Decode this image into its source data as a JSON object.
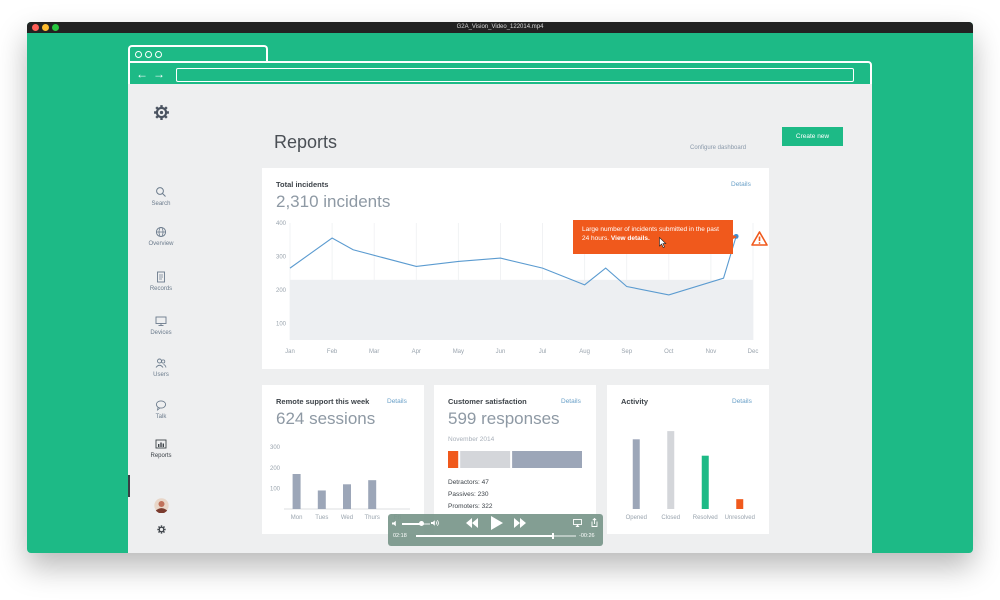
{
  "window": {
    "title": "G2A_Vision_Video_122014.mp4"
  },
  "colors": {
    "brand_green": "#1dba86",
    "alert_orange": "#f0591c",
    "bar_gray": "#9ca6b8",
    "bar_light": "#d4d6da"
  },
  "sidebar": {
    "items": [
      {
        "label": "Search",
        "icon": "search-icon"
      },
      {
        "label": "Overview",
        "icon": "globe-icon"
      },
      {
        "label": "Records",
        "icon": "document-icon"
      },
      {
        "label": "Devices",
        "icon": "monitor-icon"
      },
      {
        "label": "Users",
        "icon": "users-icon"
      },
      {
        "label": "Talk",
        "icon": "chat-icon"
      },
      {
        "label": "Reports",
        "icon": "chart-icon",
        "active": true
      }
    ]
  },
  "header": {
    "title": "Reports",
    "configure_label": "Configure dashboard",
    "create_label": "Create new"
  },
  "incidents": {
    "title": "Total incidents",
    "big": "2,310 incidents",
    "details": "Details",
    "alert_text": "Large number of incidents submitted in the past 24 hours.",
    "alert_link": "View details."
  },
  "remote": {
    "title": "Remote support this week",
    "big": "624 sessions",
    "details": "Details"
  },
  "satisfaction": {
    "title": "Customer satisfaction",
    "big": "599 responses",
    "subtitle": "November 2014",
    "details": "Details",
    "detractors": "Detractors: 47",
    "passives": "Passives: 230",
    "promoters": "Promoters: 322",
    "segments": [
      47,
      230,
      322
    ]
  },
  "activity": {
    "title": "Activity",
    "details": "Details"
  },
  "player": {
    "elapsed": "02:18",
    "remaining": "-00:26",
    "volume": 0.7,
    "progress": 0.85
  },
  "chart_data": [
    {
      "type": "line",
      "categories": [
        "Jan",
        "Feb",
        "Mar",
        "Apr",
        "May",
        "Jun",
        "Jul",
        "Aug",
        "Sep",
        "Oct",
        "Nov",
        "Dec"
      ],
      "series": [
        {
          "x": [
            0,
            1,
            1.5,
            3,
            4,
            5,
            6,
            7,
            7.5,
            8,
            9,
            10.3,
            10.6
          ],
          "values": [
            265,
            355,
            320,
            270,
            285,
            295,
            265,
            215,
            265,
            210,
            185,
            235,
            360
          ]
        }
      ],
      "yticks": [
        100,
        200,
        300,
        400
      ],
      "ylim": [
        50,
        400
      ],
      "band": [
        0,
        230
      ],
      "grid": true
    },
    {
      "type": "bar",
      "categories": [
        "Mon",
        "Tues",
        "Wed",
        "Thurs",
        "Fri"
      ],
      "values": [
        170,
        90,
        120,
        140,
        0
      ],
      "yticks": [
        100,
        200,
        300
      ],
      "ylim": [
        0,
        340
      ]
    },
    {
      "type": "bar",
      "categories": [
        "Opened",
        "Closed",
        "Resolved",
        "Unresolved"
      ],
      "values": [
        85,
        95,
        65,
        12
      ],
      "ylim": [
        0,
        100
      ],
      "colors": [
        "#9ca6b8",
        "#d4d6da",
        "#1dba86",
        "#f0591c"
      ]
    }
  ]
}
